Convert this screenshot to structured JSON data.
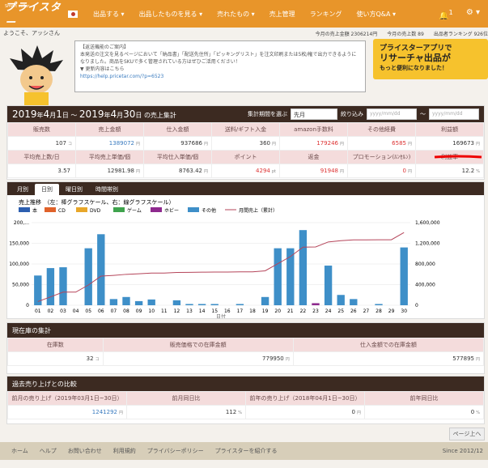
{
  "app": {
    "logo_text": "プライスター",
    "logo_small": "Smart seller"
  },
  "nav": [
    "出品する ▾",
    "出品したものを見る ▾",
    "売れたもの ▾",
    "売上管理",
    "ランキング",
    "使い方Q&A ▾"
  ],
  "topright": {
    "bell_count": "1",
    "gear": "⚙ ▾"
  },
  "subbar": {
    "greeting": "ようこそ、アッシさん",
    "today_sales": "今月の売上金額 2306214円",
    "today_count": "今月の売上数 89",
    "ranking": "出品者ランキング 926位"
  },
  "notice": {
    "title": "【返送機能のご案内】",
    "body": "本発送の注文を見るページにおいて「納品書」「配送先住所」「ピッキングリスト」を注文印刷または5枚/権で出力できるようになりました。商品をSKUで多く管理されている方はぜひご活用ください！",
    "link_label": "▼ 更新内容はこちら",
    "link": "https://help.pricetar.com/?p=6523"
  },
  "banner": {
    "line1": "プライスターアプリで",
    "line2": "リサーチャ出品が",
    "line3": "もっと便利になりました！"
  },
  "summary": {
    "title_year1": "2019",
    "title_m1": "4",
    "title_d1": "1",
    "title_year2": "2019",
    "title_m2": "4",
    "title_d2": "30",
    "title_suffix": "の売上集計",
    "period_label": "集計期間を選ぶ",
    "period_value": "先月",
    "filter_label": "絞り込み",
    "date_placeholder": "yyyy/mm/dd",
    "tilde": "～",
    "row1_labels": [
      "販売数",
      "売上金額",
      "仕入金額",
      "送料/ギフト入金",
      "amazon手数料",
      "その他経費",
      "利益額"
    ],
    "row1_values": [
      "107",
      "1389072",
      "937686",
      "360",
      "179246",
      "6585",
      "169673"
    ],
    "row1_units": [
      "コ",
      "円",
      "円",
      "円",
      "円",
      "円",
      "円"
    ],
    "row2_labels": [
      "平均売上数/日",
      "平均売上単価/個",
      "平均仕入単価/個",
      "ポイント",
      "返金",
      "プロモーション(ﾙﾝｾﾙﾝ)",
      "利益率"
    ],
    "row2_values": [
      "3.57",
      "12981.98",
      "8763.42",
      "4294",
      "91948",
      "0",
      "12.2"
    ],
    "row2_units": [
      "",
      "円",
      "円",
      "pt",
      "円",
      "円",
      "%"
    ]
  },
  "tabs": [
    "月別",
    "日別",
    "曜日別",
    "時間帯別"
  ],
  "chart_data": {
    "type": "bar",
    "title": "売上推移　（左：棒グラフスケール、右：線グラフスケール）",
    "xlabel": "日付",
    "categories": [
      "01",
      "02",
      "03",
      "04",
      "05",
      "06",
      "07",
      "08",
      "09",
      "10",
      "11",
      "12",
      "13",
      "14",
      "15",
      "16",
      "17",
      "18",
      "19",
      "20",
      "21",
      "22",
      "23",
      "24",
      "25",
      "26",
      "27",
      "28",
      "29",
      "30"
    ],
    "ylim_left": [
      0,
      200000
    ],
    "ylim_right": [
      0,
      1600000
    ],
    "yticks_left": [
      "0",
      "50,000",
      "100,000",
      "150,000",
      "200,..."
    ],
    "yticks_right": [
      "0",
      "400,000",
      "800,000",
      "1,200,000",
      "1,600,000"
    ],
    "series": [
      {
        "name": "本",
        "color": "#2d5fb0",
        "values": [
          0,
          0,
          0,
          0,
          0,
          0,
          0,
          0,
          0,
          0,
          0,
          0,
          0,
          0,
          0,
          0,
          0,
          0,
          0,
          0,
          0,
          0,
          0,
          0,
          0,
          0,
          0,
          0,
          0,
          0
        ]
      },
      {
        "name": "CD",
        "color": "#e0622a",
        "values": [
          0,
          0,
          0,
          0,
          0,
          0,
          0,
          0,
          0,
          0,
          0,
          0,
          0,
          0,
          0,
          0,
          0,
          0,
          0,
          0,
          0,
          0,
          0,
          0,
          0,
          0,
          0,
          0,
          0,
          0
        ]
      },
      {
        "name": "DVD",
        "color": "#e8a72a",
        "values": [
          0,
          0,
          0,
          0,
          0,
          0,
          0,
          0,
          0,
          0,
          0,
          0,
          0,
          0,
          0,
          0,
          0,
          0,
          0,
          0,
          0,
          0,
          0,
          0,
          0,
          0,
          0,
          0,
          0,
          0
        ]
      },
      {
        "name": "ゲーム",
        "color": "#3fa34d",
        "values": [
          0,
          0,
          0,
          0,
          0,
          0,
          0,
          0,
          0,
          0,
          0,
          0,
          0,
          0,
          0,
          0,
          0,
          0,
          0,
          0,
          0,
          0,
          0,
          0,
          0,
          0,
          0,
          0,
          0,
          0
        ]
      },
      {
        "name": "ホビー",
        "color": "#8e2a8e",
        "values": [
          0,
          0,
          0,
          0,
          0,
          0,
          0,
          0,
          0,
          0,
          0,
          0,
          0,
          0,
          0,
          0,
          0,
          0,
          0,
          0,
          0,
          0,
          5000,
          0,
          0,
          0,
          0,
          0,
          0,
          0
        ]
      },
      {
        "name": "その他",
        "color": "#3e8fc8",
        "values": [
          72000,
          90000,
          92000,
          0,
          138000,
          172000,
          15000,
          20000,
          10000,
          14000,
          0,
          12000,
          3000,
          3000,
          3000,
          0,
          3000,
          0,
          20000,
          138000,
          138000,
          182000,
          0,
          96000,
          25000,
          15000,
          0,
          3000,
          0,
          140000
        ]
      }
    ],
    "line": {
      "name": "月間売上（累計）",
      "color": "#b5455a",
      "values": [
        72000,
        162000,
        254000,
        254000,
        392000,
        564000,
        579000,
        599000,
        609000,
        623000,
        623000,
        635000,
        638000,
        641000,
        644000,
        644000,
        647000,
        647000,
        667000,
        805000,
        943000,
        1125000,
        1130000,
        1226000,
        1251000,
        1266000,
        1266000,
        1269000,
        1269000,
        1409000
      ]
    }
  },
  "stock": {
    "title": "現在庫の集計",
    "labels": [
      "在庫数",
      "販売価格での在庫金額",
      "仕入金額での在庫金額"
    ],
    "values": [
      "32",
      "779950",
      "577895"
    ],
    "units": [
      "コ",
      "円",
      "円"
    ]
  },
  "compare": {
    "title": "過去売り上げとの比較",
    "labels": [
      "前月の売り上げ（2019年03月1日~30日）",
      "前月同日比",
      "前年の売り上げ（2018年04月1日~30日）",
      "前年同日比"
    ],
    "values": [
      "1241292",
      "112",
      "0",
      "0"
    ],
    "units": [
      "円",
      "%",
      "円",
      "%"
    ]
  },
  "pagetop": "ページ上へ",
  "footer": [
    "ホーム",
    "ヘルプ",
    "お問い合わせ",
    "利用規約",
    "プライバシーポリシー",
    "プライスターを紹介する"
  ],
  "copyright": "Since 2012/12"
}
